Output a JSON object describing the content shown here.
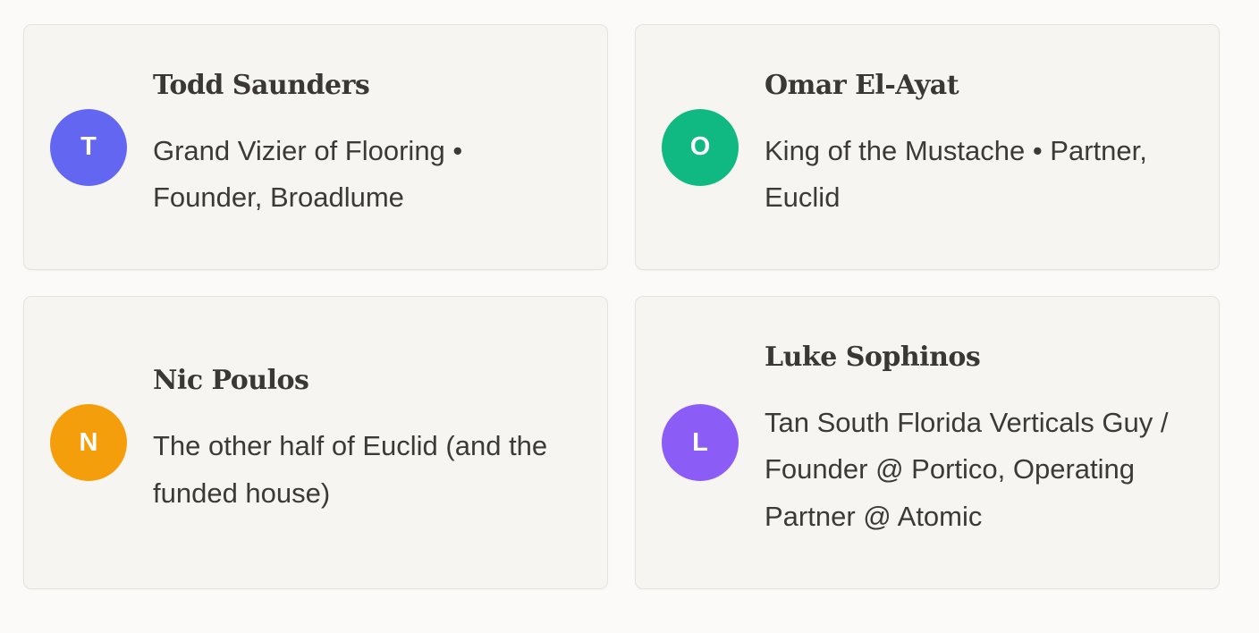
{
  "people": [
    {
      "initial": "T",
      "name": "Todd Saunders",
      "role": "Grand Vizier of Flooring • Founder, Broadlume",
      "avatar_color": "#6366f1"
    },
    {
      "initial": "O",
      "name": "Omar El-Ayat",
      "role": "King of the Mustache • Partner, Euclid",
      "avatar_color": "#10b981"
    },
    {
      "initial": "N",
      "name": "Nic Poulos",
      "role": "The other half of Euclid (and the funded house)",
      "avatar_color": "#f59e0b"
    },
    {
      "initial": "L",
      "name": "Luke Sophinos",
      "role": "Tan South Florida Verticals Guy / Founder @ Portico, Operating Partner @ Atomic",
      "avatar_color": "#8b5cf6"
    }
  ]
}
